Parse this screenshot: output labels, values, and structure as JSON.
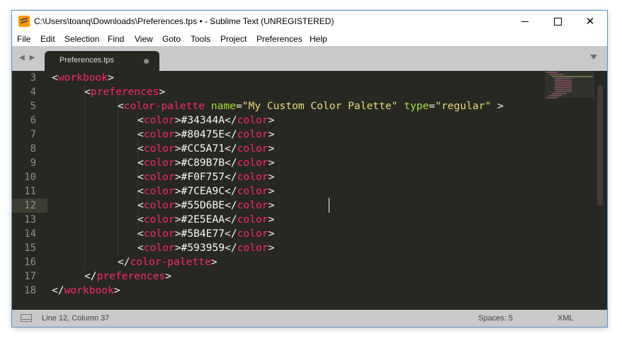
{
  "window": {
    "title": "C:\\Users\\toanq\\Downloads\\Preferences.tps • - Sublime Text (UNREGISTERED)",
    "minimize_icon": "minimize-icon",
    "maximize_icon": "maximize-icon",
    "close_glyph": "✕"
  },
  "menu": [
    "File",
    "Edit",
    "Selection",
    "Find",
    "View",
    "Goto",
    "Tools",
    "Project",
    "Preferences",
    "Help"
  ],
  "tabs": {
    "nav_arrows": "◀ ▶",
    "active": {
      "label": "Preferences.tps",
      "dirty": true
    }
  },
  "editor": {
    "line_numbers": [
      "3",
      "4",
      "5",
      "6",
      "7",
      "8",
      "9",
      "10",
      "11",
      "12",
      "13",
      "14",
      "15",
      "16",
      "17",
      "18"
    ],
    "current_line": "12",
    "colors": [
      "#34344A",
      "#80475E",
      "#CC5A71",
      "#C89B7B",
      "#F0F757",
      "#7CEA9C",
      "#55D6BE",
      "#2E5EAA",
      "#5B4E77",
      "#593959"
    ],
    "code": {
      "lt": "<",
      "lt_slash": "</",
      "gt": ">",
      "gt_space": " >",
      "eq": "=",
      "space": " ",
      "workbook": "workbook",
      "preferences": "preferences",
      "color_palette": "color-palette",
      "color": "color",
      "attr_name": "name",
      "attr_name_value": "\"My Custom Color Palette\"",
      "attr_type": "type",
      "attr_type_value": "\"regular\""
    },
    "theme": {
      "background": "#272822",
      "tag": "#f92672",
      "attribute": "#a6e22e",
      "string": "#e6db74",
      "text": "#f8f8f2",
      "line_number": "#90908a"
    }
  },
  "status": {
    "position": "Line 12, Column 37",
    "spaces": "Spaces: 5",
    "syntax": "XML"
  }
}
